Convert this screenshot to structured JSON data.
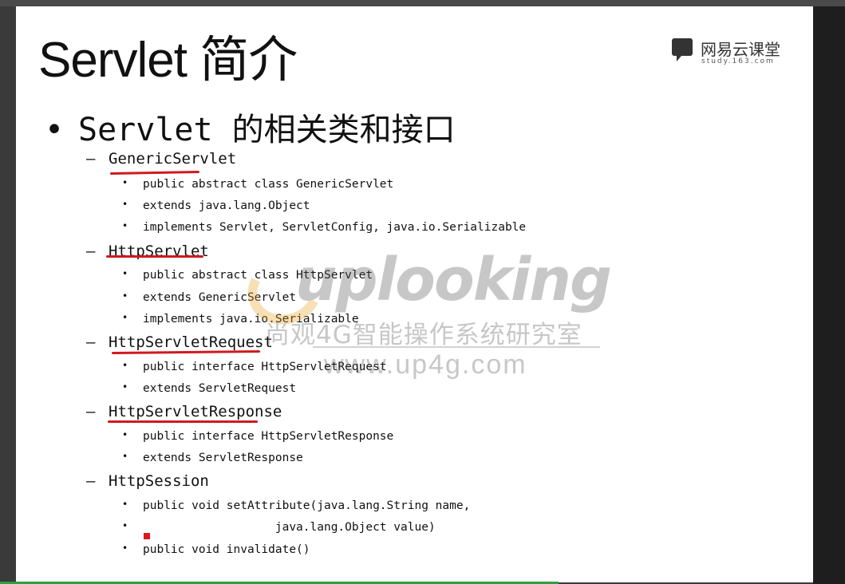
{
  "slide": {
    "title": "Servlet 简介",
    "logo": {
      "cn": "网易云课堂",
      "en": "study.163.com"
    },
    "main_bullet_symbol": "•",
    "main_bullet": "Servlet 的相关类和接口",
    "sections": [
      {
        "name": "GenericServlet",
        "items": [
          "public abstract class GenericServlet",
          "extends java.lang.Object",
          "implements Servlet, ServletConfig, java.io.Serializable"
        ]
      },
      {
        "name": "HttpServlet",
        "items": [
          "public abstract class HttpServlet",
          "extends GenericServlet",
          "implements java.io.Serializable"
        ]
      },
      {
        "name": "HttpServletRequest",
        "items": [
          "public interface HttpServletRequest",
          "extends ServletRequest"
        ]
      },
      {
        "name": "HttpServletResponse",
        "items": [
          "public interface HttpServletResponse",
          "extends ServletResponse"
        ]
      },
      {
        "name": "HttpSession",
        "items": [
          "public void setAttribute(java.lang.String name,",
          "                   java.lang.Object value)",
          "public void invalidate()"
        ]
      }
    ],
    "dash": "–",
    "sub_bullet": "•"
  },
  "watermark": {
    "brand": "uplooking",
    "cn": "尚观4G智能操作系统研究室",
    "url": "www.up4g.com"
  },
  "colors": {
    "underline": "#d0191f",
    "watermark_arc": "#e8a020",
    "progress": "#2f9e44"
  }
}
